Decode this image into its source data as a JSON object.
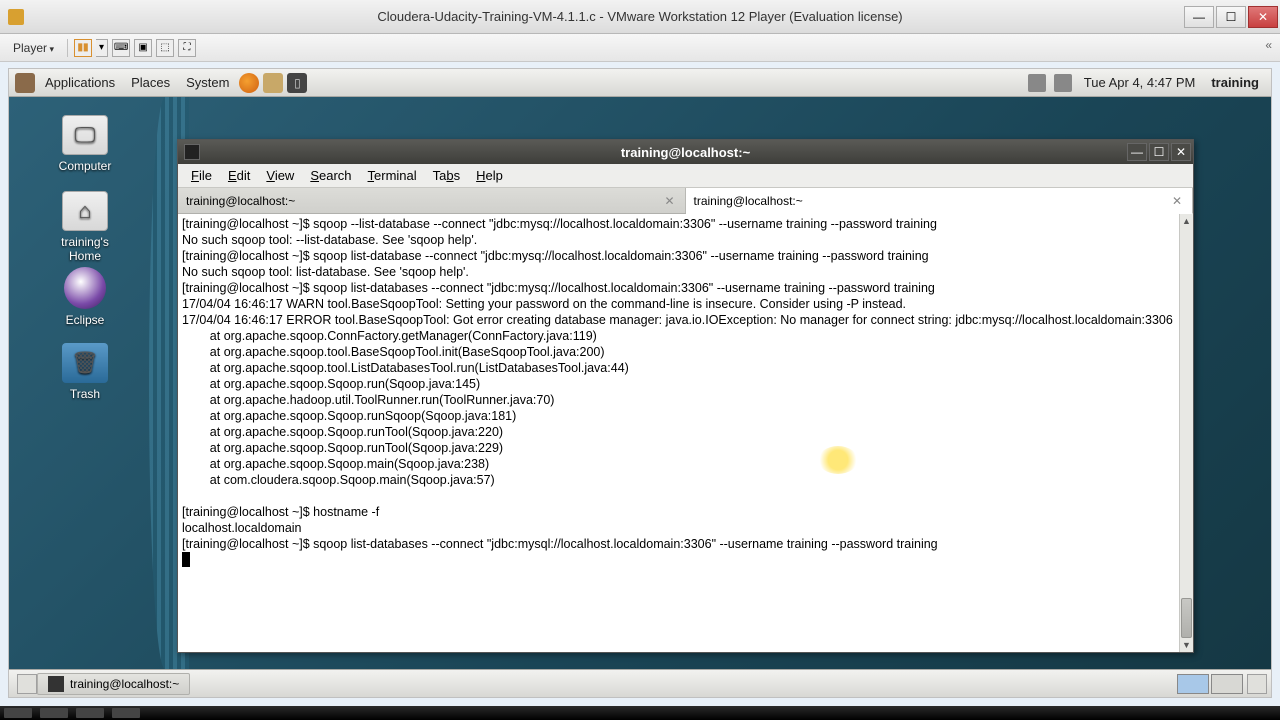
{
  "host": {
    "title": "Cloudera-Udacity-Training-VM-4.1.1.c - VMware Workstation 12 Player (Evaluation license)",
    "player_menu": "Player",
    "win_controls": {
      "min": "—",
      "max": "☐",
      "close": "✕"
    }
  },
  "gnome": {
    "applications": "Applications",
    "places": "Places",
    "system": "System",
    "datetime": "Tue Apr  4,  4:47 PM",
    "user": "training",
    "task_title": "training@localhost:~"
  },
  "desktop_icons": {
    "computer": "Computer",
    "home": "training's Home",
    "eclipse": "Eclipse",
    "trash": "Trash"
  },
  "terminal": {
    "title": "training@localhost:~",
    "menus": {
      "file": "File",
      "edit": "Edit",
      "view": "View",
      "search": "Search",
      "terminal": "Terminal",
      "tabs": "Tabs",
      "help": "Help"
    },
    "tabs": [
      {
        "label": "training@localhost:~"
      },
      {
        "label": "training@localhost:~"
      }
    ],
    "content": "[training@localhost ~]$ sqoop --list-database --connect \"jdbc:mysq://localhost.localdomain:3306\" --username training --password training\nNo such sqoop tool: --list-database. See 'sqoop help'.\n[training@localhost ~]$ sqoop list-database --connect \"jdbc:mysq://localhost.localdomain:3306\" --username training --password training\nNo such sqoop tool: list-database. See 'sqoop help'.\n[training@localhost ~]$ sqoop list-databases --connect \"jdbc:mysq://localhost.localdomain:3306\" --username training --password training\n17/04/04 16:46:17 WARN tool.BaseSqoopTool: Setting your password on the command-line is insecure. Consider using -P instead.\n17/04/04 16:46:17 ERROR tool.BaseSqoopTool: Got error creating database manager: java.io.IOException: No manager for connect string: jdbc:mysq://localhost.localdomain:3306\n        at org.apache.sqoop.ConnFactory.getManager(ConnFactory.java:119)\n        at org.apache.sqoop.tool.BaseSqoopTool.init(BaseSqoopTool.java:200)\n        at org.apache.sqoop.tool.ListDatabasesTool.run(ListDatabasesTool.java:44)\n        at org.apache.sqoop.Sqoop.run(Sqoop.java:145)\n        at org.apache.hadoop.util.ToolRunner.run(ToolRunner.java:70)\n        at org.apache.sqoop.Sqoop.runSqoop(Sqoop.java:181)\n        at org.apache.sqoop.Sqoop.runTool(Sqoop.java:220)\n        at org.apache.sqoop.Sqoop.runTool(Sqoop.java:229)\n        at org.apache.sqoop.Sqoop.main(Sqoop.java:238)\n        at com.cloudera.sqoop.Sqoop.main(Sqoop.java:57)\n\n[training@localhost ~]$ hostname -f\nlocalhost.localdomain\n[training@localhost ~]$ sqoop list-databases --connect \"jdbc:mysql://localhost.localdomain:3306\" --username training --password training\n"
  }
}
